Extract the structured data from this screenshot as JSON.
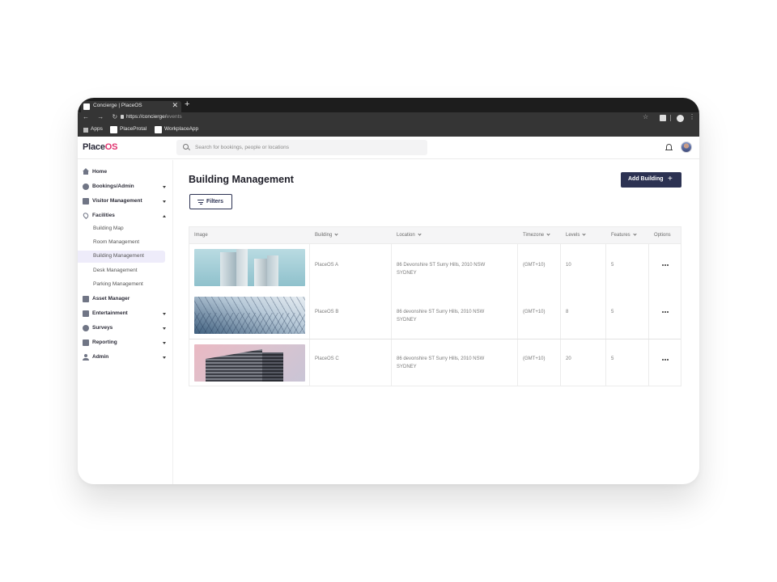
{
  "browser": {
    "tab_title": "Concierge | PlaceOS",
    "tab_close": "✕",
    "new_tab": "+",
    "nav_arrows": "← → ↻",
    "url_base": "https://concierge/",
    "url_path": "events",
    "bookmarks": [
      "Apps",
      "PlaceProtal",
      "WorkplaceApp"
    ]
  },
  "app": {
    "logo_main": "Place",
    "logo_accent": "OS",
    "search_placeholder": "Search for bookings, people or locations"
  },
  "sidebar": {
    "items": [
      {
        "label": "Home",
        "icon": "home-icon"
      },
      {
        "label": "Bookings/Admin",
        "icon": "bookings-icon",
        "caret": "down"
      },
      {
        "label": "Visitor Management",
        "icon": "visitor-icon",
        "caret": "down"
      },
      {
        "label": "Facilities",
        "icon": "location-pin-icon",
        "caret": "up"
      },
      {
        "label": "Asset Manager",
        "icon": "asset-icon"
      },
      {
        "label": "Entertainment",
        "icon": "entertainment-icon",
        "caret": "down"
      },
      {
        "label": "Surveys",
        "icon": "surveys-icon",
        "caret": "down"
      },
      {
        "label": "Reporting",
        "icon": "reporting-icon",
        "caret": "down"
      },
      {
        "label": "Admin",
        "icon": "person-icon",
        "caret": "down"
      }
    ],
    "facilities_sub": [
      "Building Map",
      "Room Management",
      "Building Management",
      "Desk Management",
      "Parking Management"
    ],
    "active_sub": "Building Management"
  },
  "main": {
    "title": "Building Management",
    "add_button": "Add Building",
    "filters_button": "Filters"
  },
  "table": {
    "headers": [
      "Image",
      "Building",
      "Location",
      "Timezone",
      "Levels",
      "Features",
      "Options"
    ],
    "rows": [
      {
        "building": "PlaceOS A",
        "location_line1": "86 Devonshire ST Surry Hills, 2010 NSW",
        "location_line2": "SYDNEY",
        "timezone": "(GMT+10)",
        "levels": "10",
        "features": "5"
      },
      {
        "building": "PlaceOS B",
        "location_line1": "86 devonshire ST Surry Hills, 2010 NSW",
        "location_line2": "SYDNEY",
        "timezone": "(GMT+10)",
        "levels": "8",
        "features": "5"
      },
      {
        "building": "PlaceOS C",
        "location_line1": "86 devonshire ST Surry Hills, 2010 NSW",
        "location_line2": "SYDNEY",
        "timezone": "(GMT+10)",
        "levels": "20",
        "features": "5"
      }
    ]
  },
  "colors": {
    "brand_accent": "#e0336f",
    "primary": "#2c3252",
    "active_bg": "#eeecfa"
  }
}
